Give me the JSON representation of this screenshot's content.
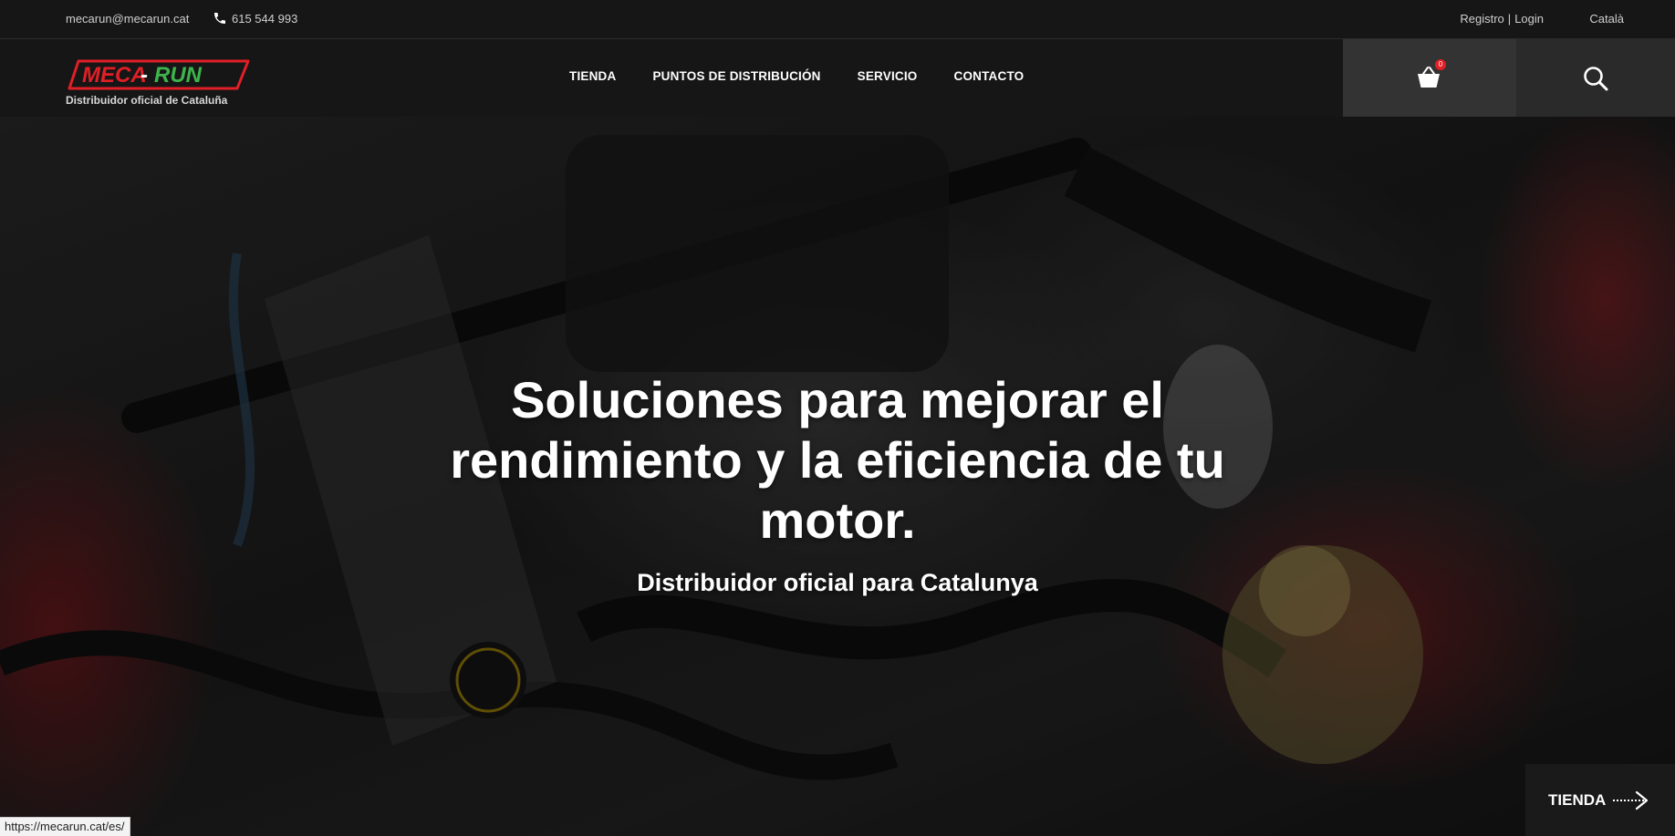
{
  "topbar": {
    "email": "mecarun@mecarun.cat",
    "phone": "615 544 993",
    "register": "Registro",
    "separator": "|",
    "login": "Login",
    "language": "Català"
  },
  "header": {
    "logo_text": "MECA-RUN",
    "logo_subtitle": "Distribuidor oficial de Cataluña",
    "nav": [
      "TIENDA",
      "PUNTOS DE DISTRIBUCIÓN",
      "SERVICIO",
      "CONTACTO"
    ],
    "cart_count": "0"
  },
  "hero": {
    "title": "Soluciones para mejorar el rendimiento y la eficiencia de tu motor.",
    "subtitle": "Distribuidor oficial para Catalunya",
    "cta": "TIENDA"
  },
  "status_url": "https://mecarun.cat/es/",
  "colors": {
    "brand_red": "#e11f26",
    "brand_green": "#3cb54a",
    "bar_bg": "#161616"
  },
  "icons": [
    "phone-icon",
    "cart-icon",
    "search-icon",
    "arrow-right-icon"
  ]
}
